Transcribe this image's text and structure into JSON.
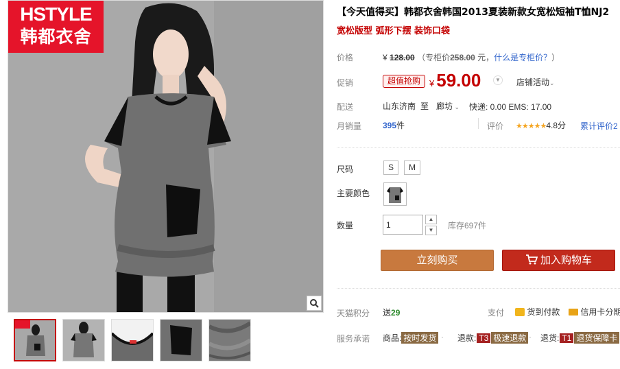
{
  "gallery": {
    "brand_logo": {
      "line1": "HSTYLE",
      "line2": "韩都衣舍"
    },
    "zoom_icon": "magnifier-icon",
    "thumb_logo_text": "HSTYLE"
  },
  "product": {
    "title": "【今天值得买】韩都衣舍韩国2013夏装新款女宽松短袖T恤NJ2",
    "subtitle": "宽松版型 弧形下摆 装饰口袋"
  },
  "price": {
    "label": "价格",
    "currency": "¥",
    "original": "128.00",
    "counter_prefix": "（专柜价",
    "counter_price": "258.00",
    "counter_suffix": " 元，",
    "what_link": "什么是专柜价？",
    "close_paren": "）"
  },
  "promo": {
    "label": "促销",
    "badge": "超值抢购",
    "currency": "¥",
    "price": "59.00",
    "dropdown_icon": "chevron-down-icon",
    "shop_activity": "店铺活动"
  },
  "delivery": {
    "label": "配送",
    "from": "山东济南",
    "to_word": "至",
    "to": "廊坊",
    "fees": "快递: 0.00 EMS: 17.00"
  },
  "sales": {
    "label": "月销量",
    "count": "395",
    "unit": "件",
    "rating_label": "评价",
    "stars": "★★★★★",
    "score": "4.8分",
    "review_link": "累计评价2"
  },
  "size": {
    "label": "尺码",
    "options": [
      "S",
      "M"
    ]
  },
  "color": {
    "label": "主要颜色"
  },
  "quantity": {
    "label": "数量",
    "value": "1",
    "up_icon": "chevron-up-icon",
    "down_icon": "chevron-down-icon",
    "stock": "库存697件"
  },
  "actions": {
    "buy_now": "立刻购买",
    "add_to_cart": "加入购物车"
  },
  "points": {
    "label": "天猫积分",
    "give": "送",
    "amount": "29",
    "pay_label": "支付",
    "cod": "货到付款",
    "credit": "信用卡分期"
  },
  "service": {
    "label": "服务承诺",
    "goods_prefix": "商品:",
    "goods_badge": "按时发货",
    "refund_prefix": "退款:",
    "refund_code": "T3",
    "refund_badge": "极速退款",
    "return_prefix": "退货:",
    "return_code": "T1",
    "return_badge": "退货保障卡"
  }
}
